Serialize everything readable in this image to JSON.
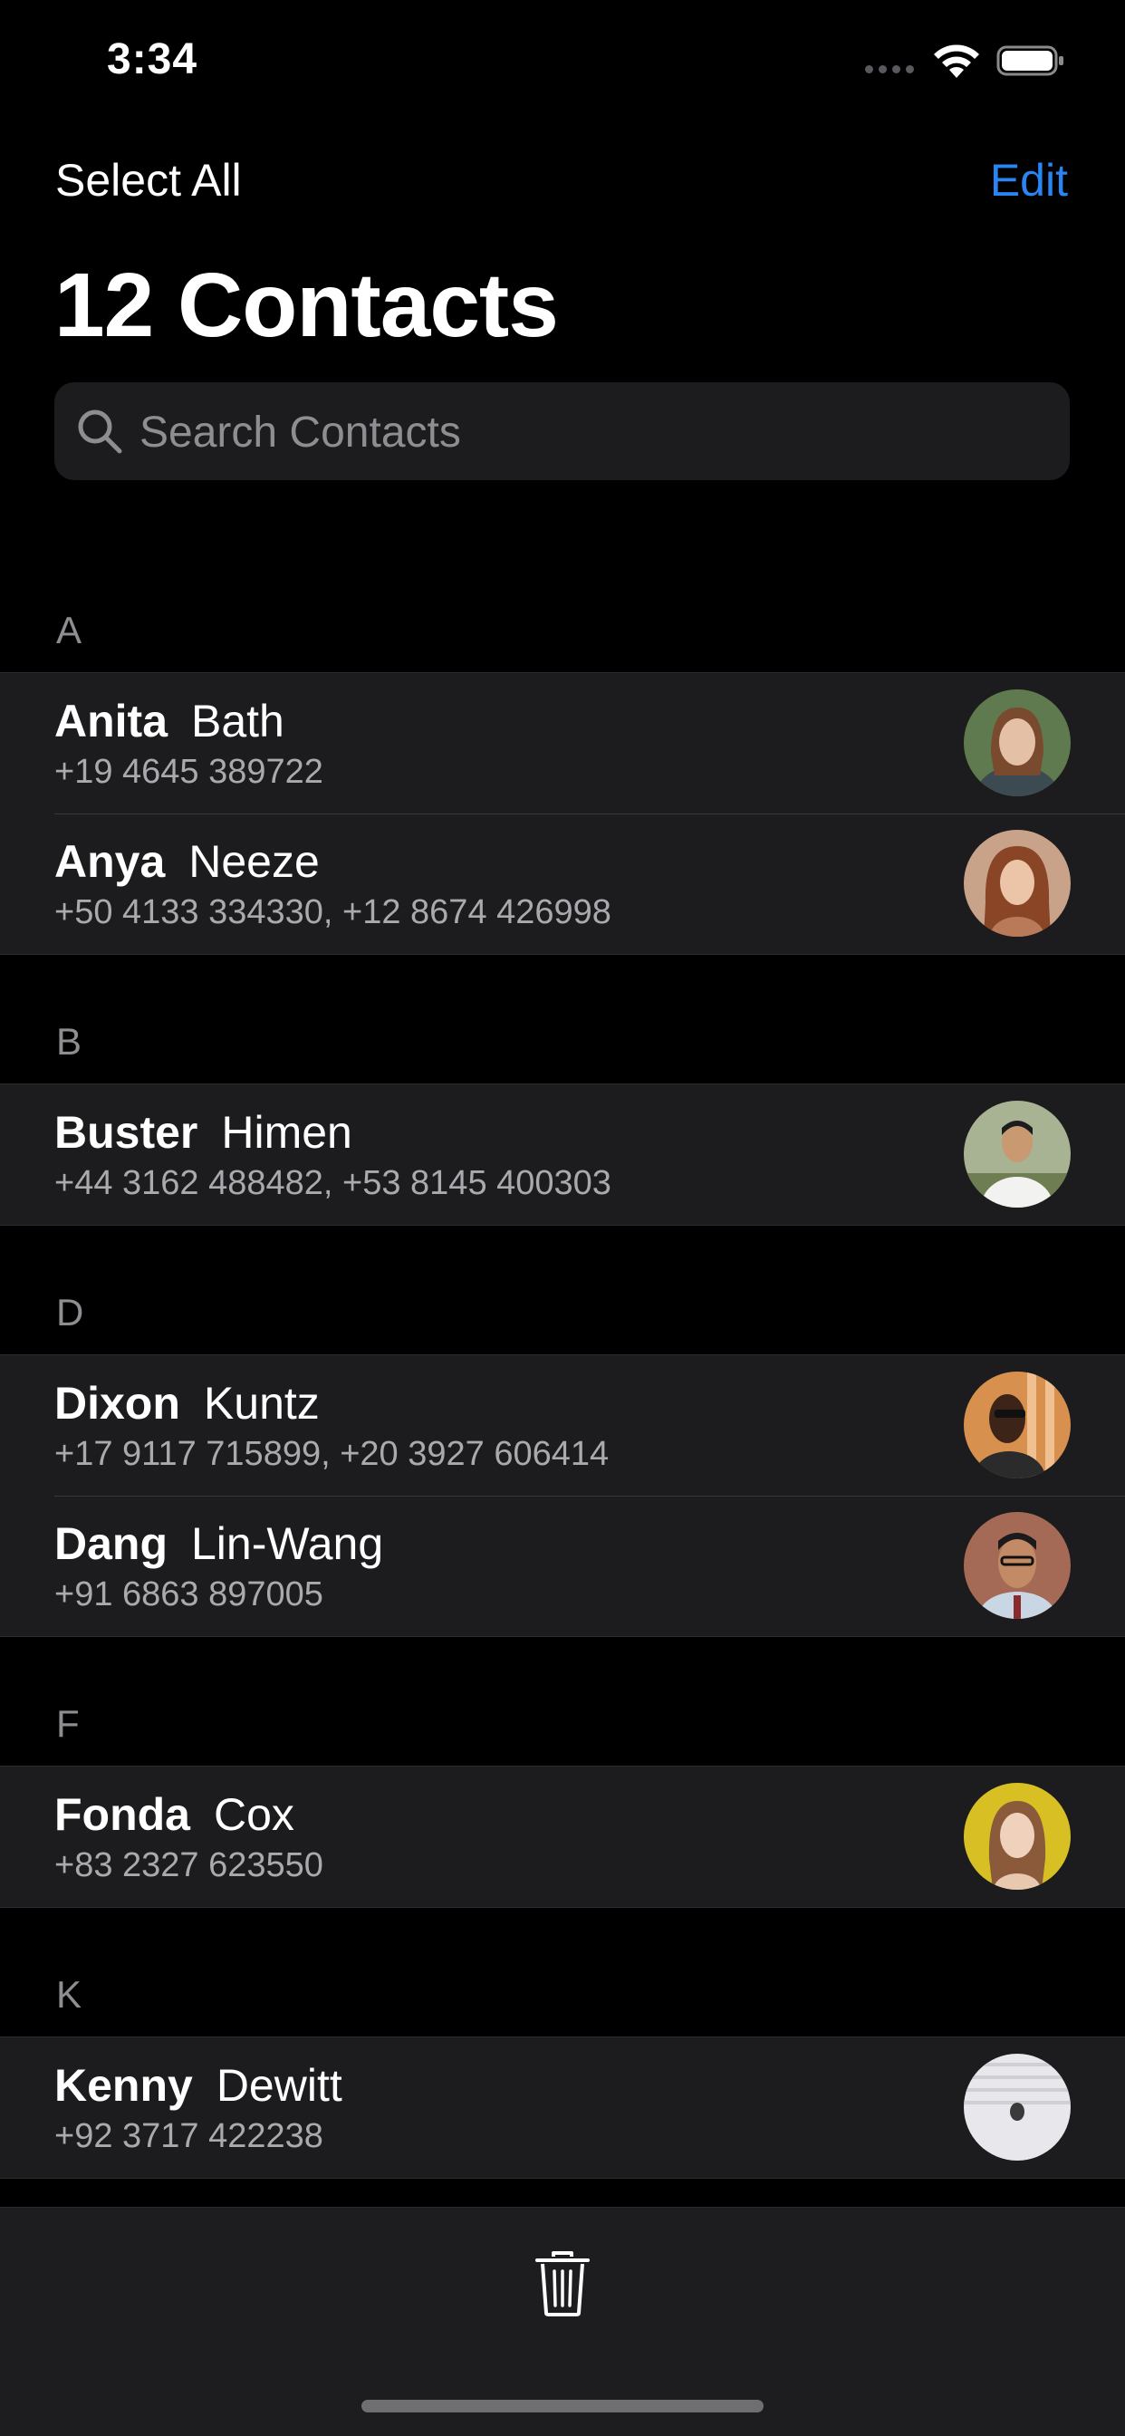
{
  "status_bar": {
    "time": "3:34"
  },
  "nav": {
    "left_label": "Select All",
    "right_label": "Edit"
  },
  "title": "12 Contacts",
  "search": {
    "placeholder": "Search Contacts"
  },
  "sections": [
    {
      "letter": "A",
      "contacts": [
        {
          "first": "Anita",
          "last": "Bath",
          "phones": "+19 4645 389722",
          "avatar_color": "#6b8f5a"
        },
        {
          "first": "Anya",
          "last": "Neeze",
          "phones": "+50 4133 334330, +12 8674 426998",
          "avatar_color": "#a8643c"
        }
      ]
    },
    {
      "letter": "B",
      "contacts": [
        {
          "first": "Buster",
          "last": "Himen",
          "phones": "+44 3162 488482, +53 8145 400303",
          "avatar_color": "#8a9a7c"
        }
      ]
    },
    {
      "letter": "D",
      "contacts": [
        {
          "first": "Dixon",
          "last": "Kuntz",
          "phones": "+17 9117 715899, +20 3927 606414",
          "avatar_color": "#c98a4a"
        },
        {
          "first": "Dang",
          "last": "Lin-Wang",
          "phones": "+91 6863 897005",
          "avatar_color": "#9c6a52"
        }
      ]
    },
    {
      "letter": "F",
      "contacts": [
        {
          "first": "Fonda",
          "last": "Cox",
          "phones": "+83 2327 623550",
          "avatar_color": "#d8c030"
        }
      ]
    },
    {
      "letter": "K",
      "contacts": [
        {
          "first": "Kenny",
          "last": "Dewitt",
          "phones": "+92 3717 422238",
          "avatar_color": "#e6e6ea"
        }
      ]
    }
  ],
  "toolbar": {
    "trash_icon": "trash-icon"
  },
  "colors": {
    "accent": "#2a84f2",
    "background": "#000000",
    "cell": "#1c1c1e"
  }
}
